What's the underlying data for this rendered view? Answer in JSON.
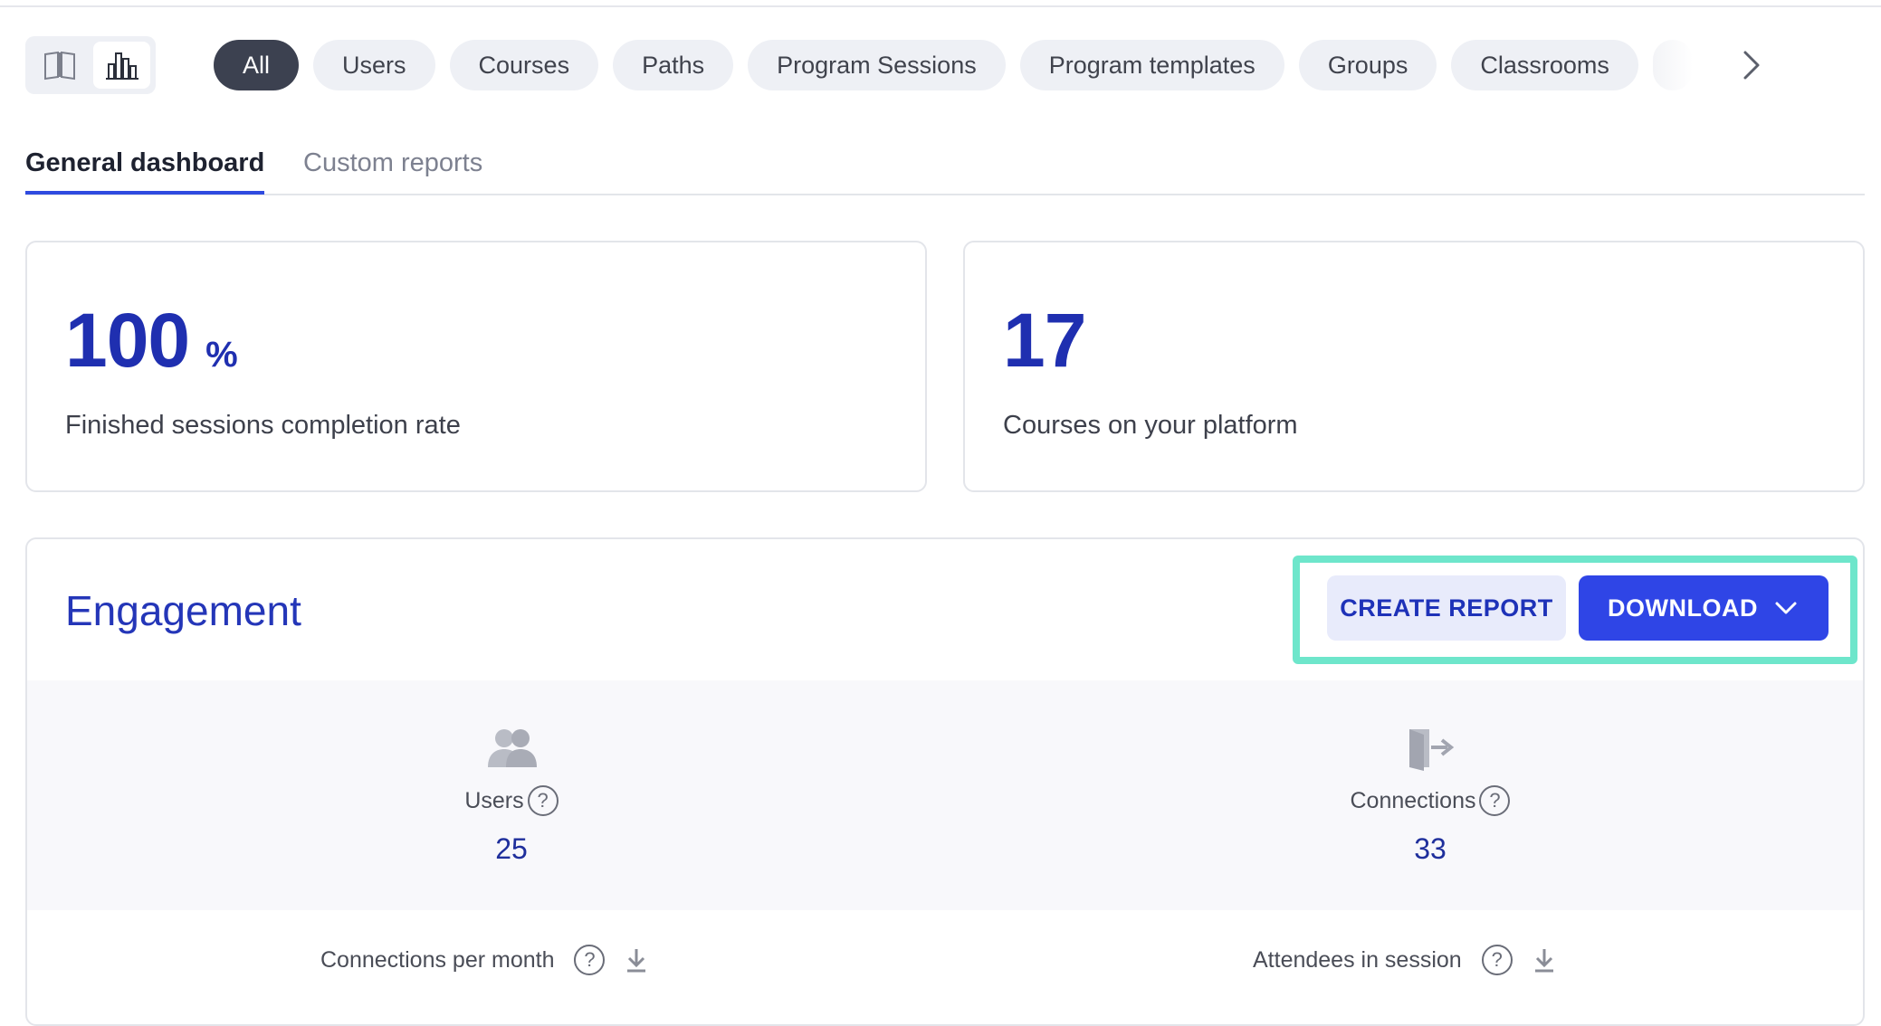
{
  "view_toggle": {
    "items": [
      {
        "name": "catalog-view",
        "icon": "book-icon",
        "active": false
      },
      {
        "name": "analytics-view",
        "icon": "bar-chart-icon",
        "active": true
      }
    ]
  },
  "filters": {
    "chips": [
      "All",
      "Users",
      "Courses",
      "Paths",
      "Program Sessions",
      "Program templates",
      "Groups",
      "Classrooms"
    ],
    "active": "All"
  },
  "tabs": {
    "general": "General dashboard",
    "custom": "Custom reports"
  },
  "kpis": {
    "completion": {
      "value": "100",
      "unit": "%",
      "label": "Finished sessions completion rate"
    },
    "courses": {
      "value": "17",
      "label": "Courses on your platform"
    }
  },
  "engagement": {
    "title": "Engagement",
    "create_report_label": "CREATE REPORT",
    "download_label": "DOWNLOAD",
    "stats": {
      "users": {
        "label": "Users",
        "value": "25",
        "icon": "users-icon"
      },
      "connections": {
        "label": "Connections",
        "value": "33",
        "icon": "login-door-icon"
      }
    },
    "subcharts": {
      "left": "Connections per month",
      "right": "Attendees in session"
    }
  },
  "colors": {
    "accent": "#2f45e6",
    "kpi_text": "#1f2fb0",
    "highlight": "#6ee6cb",
    "chip_active": "#3c4150"
  }
}
